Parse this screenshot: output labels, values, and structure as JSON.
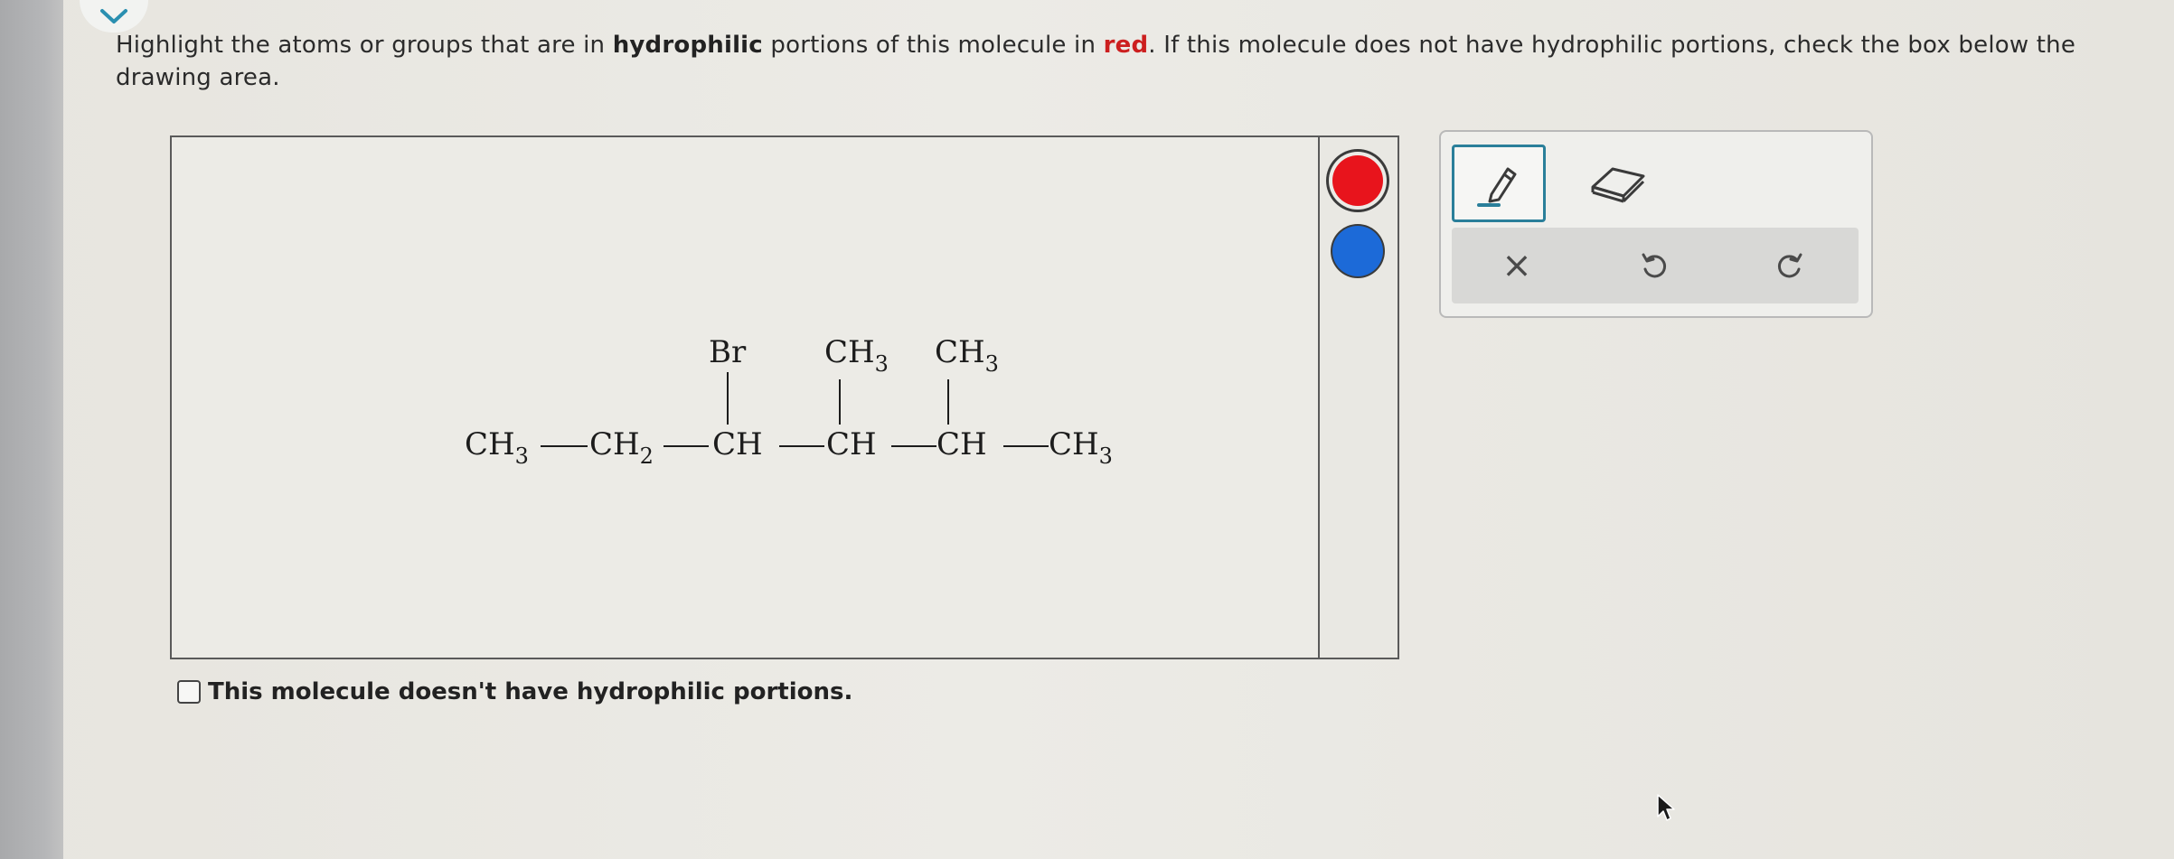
{
  "prompt": {
    "part1": "Highlight the atoms or groups that are in ",
    "bold_word": "hydrophilic",
    "part2": " portions of this molecule in ",
    "red_word": "red",
    "part3": ". If this molecule does not have hydrophilic portions, check the box below the drawing area."
  },
  "molecule": {
    "main_chain": [
      "CH",
      "CH",
      "CH",
      "CH",
      "CH",
      "CH"
    ],
    "main_subs": [
      "3",
      "2",
      "",
      "",
      "",
      "3"
    ],
    "substituents": [
      {
        "label": "Br",
        "sub": ""
      },
      {
        "label": "CH",
        "sub": "3"
      },
      {
        "label": "CH",
        "sub": "3"
      }
    ]
  },
  "colors": {
    "red_swatch": "#e8141c",
    "blue_swatch": "#1c6ad8",
    "accent": "#2a7f9a"
  },
  "toolbar": {
    "tools": [
      "pencil-icon",
      "eraser-icon"
    ],
    "clear_label": "×",
    "undo_icon": "undo-icon",
    "redo_icon": "redo-icon"
  },
  "checkbox": {
    "label": "This molecule doesn't have hydrophilic portions.",
    "checked": false
  }
}
